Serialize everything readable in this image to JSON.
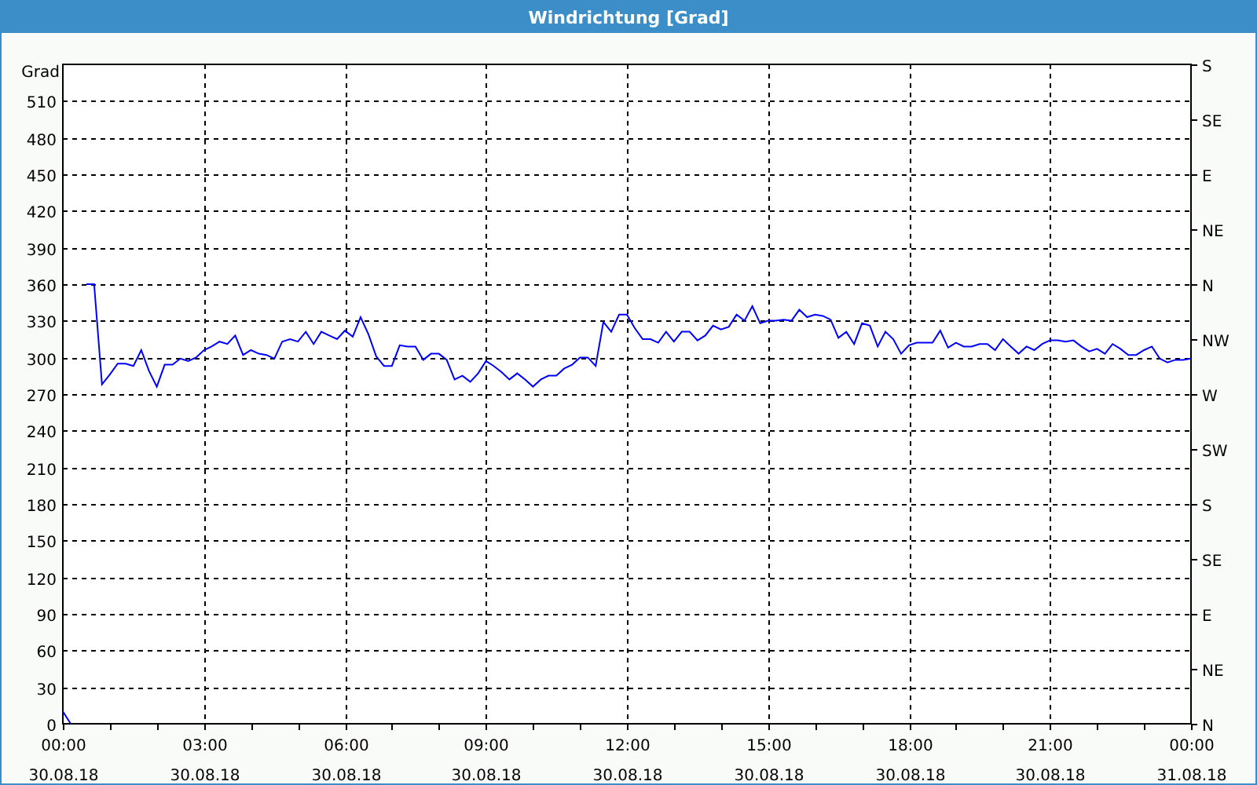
{
  "window": {
    "title": "Windrichtung [Grad]"
  },
  "chart": {
    "right_axis_labels": [
      "S",
      "SE",
      "E",
      "NE",
      "N",
      "NW",
      "W",
      "SW",
      "S",
      "SE",
      "E",
      "NE",
      "N"
    ],
    "chart_data": {
      "type": "line",
      "grid": true,
      "ylabel": "Grad",
      "ylim": [
        0,
        540
      ],
      "yticks": [
        0,
        30,
        60,
        90,
        120,
        150,
        180,
        210,
        240,
        270,
        300,
        330,
        360,
        390,
        420,
        450,
        480,
        510
      ],
      "categories": [
        "00:00\n30.08.18",
        null,
        null,
        null,
        null,
        null,
        null,
        null,
        null,
        null,
        null,
        null,
        null,
        null,
        null,
        null,
        null,
        null,
        "03:00\n30.08.18",
        null,
        null,
        null,
        null,
        null,
        null,
        null,
        null,
        null,
        null,
        null,
        null,
        null,
        null,
        null,
        null,
        null,
        "06:00\n30.08.18",
        null,
        null,
        null,
        null,
        null,
        null,
        null,
        null,
        null,
        null,
        null,
        null,
        null,
        null,
        null,
        null,
        null,
        "09:00\n30.08.18",
        null,
        null,
        null,
        null,
        null,
        null,
        null,
        null,
        null,
        null,
        null,
        null,
        null,
        null,
        null,
        null,
        null,
        "12:00\n30.08.18",
        null,
        null,
        null,
        null,
        null,
        null,
        null,
        null,
        null,
        null,
        null,
        null,
        null,
        null,
        null,
        null,
        null,
        "15:00\n30.08.18",
        null,
        null,
        null,
        null,
        null,
        null,
        null,
        null,
        null,
        null,
        null,
        null,
        null,
        null,
        null,
        null,
        null,
        "18:00\n30.08.18",
        null,
        null,
        null,
        null,
        null,
        null,
        null,
        null,
        null,
        null,
        null,
        null,
        null,
        null,
        null,
        null,
        null,
        "21:00\n30.08.18",
        null,
        null,
        null,
        null,
        null,
        null,
        null,
        null,
        null,
        null,
        null,
        null,
        null,
        null,
        null,
        null,
        null,
        "00:00\n31.08.18"
      ],
      "series": [
        {
          "color": "#0000ff",
          "values": [
            10,
            0,
            null,
            360,
            360,
            278,
            286,
            295,
            295,
            293,
            306,
            289,
            276,
            294,
            294,
            299,
            297,
            300,
            306,
            309,
            313,
            311,
            318,
            302,
            306,
            303,
            302,
            299,
            313,
            315,
            313,
            321,
            311,
            321,
            318,
            315,
            322,
            317,
            333,
            319,
            301,
            293,
            293,
            310,
            309,
            309,
            298,
            303,
            303,
            298,
            282,
            285,
            280,
            287,
            297,
            293,
            288,
            282,
            287,
            282,
            276,
            282,
            285,
            285,
            291,
            294,
            300,
            300,
            293,
            329,
            321,
            335,
            335,
            324,
            315,
            315,
            312,
            321,
            313,
            321,
            321,
            314,
            318,
            326,
            323,
            325,
            335,
            330,
            342,
            328,
            330,
            330,
            331,
            330,
            339,
            333,
            335,
            334,
            331,
            316,
            321,
            311,
            328,
            326,
            309,
            321,
            315,
            303,
            310,
            312,
            312,
            312,
            322,
            308,
            312,
            309,
            309,
            311,
            311,
            306,
            315,
            309,
            303,
            309,
            306,
            311,
            314,
            314,
            313,
            314,
            309,
            305,
            307,
            303,
            311,
            307,
            302,
            302,
            306,
            309,
            299,
            296,
            298,
            298,
            299
          ]
        }
      ]
    }
  }
}
